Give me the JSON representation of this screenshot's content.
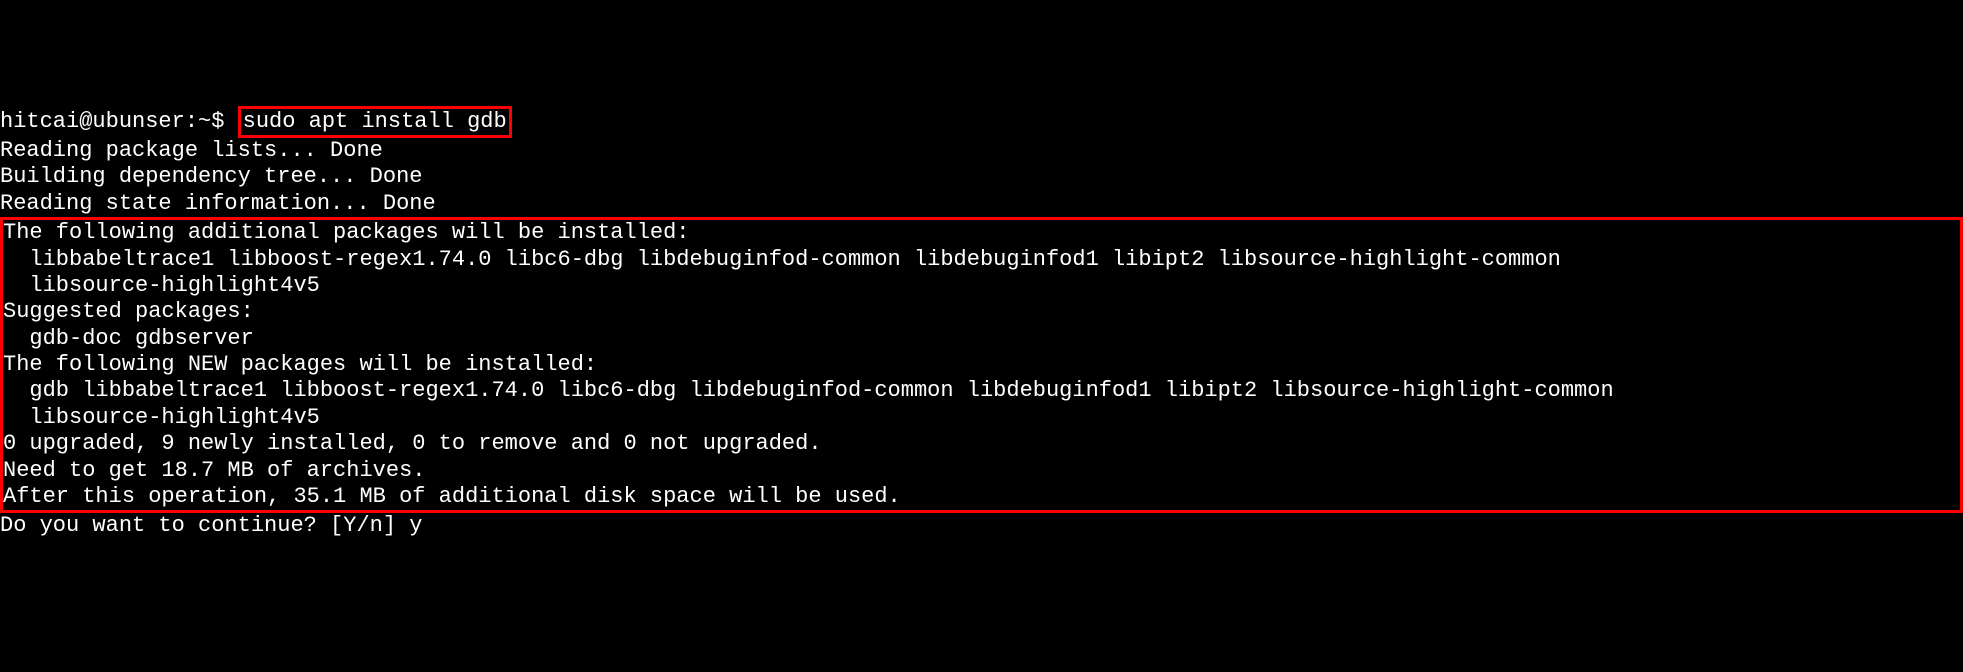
{
  "terminal": {
    "truncated_line": "hitcai@ubunser:~$",
    "prompt": "hitcai@ubunser:~$ ",
    "command": "sudo apt install gdb",
    "progress": {
      "line1": "Reading package lists... Done",
      "line2": "Building dependency tree... Done",
      "line3": "Reading state information... Done"
    },
    "box": {
      "line1": "The following additional packages will be installed:",
      "line2": "  libbabeltrace1 libboost-regex1.74.0 libc6-dbg libdebuginfod-common libdebuginfod1 libipt2 libsource-highlight-common",
      "line3": "  libsource-highlight4v5",
      "line4": "Suggested packages:",
      "line5": "  gdb-doc gdbserver",
      "line6": "The following NEW packages will be installed:",
      "line7": "  gdb libbabeltrace1 libboost-regex1.74.0 libc6-dbg libdebuginfod-common libdebuginfod1 libipt2 libsource-highlight-common",
      "line8": "  libsource-highlight4v5",
      "line9": "0 upgraded, 9 newly installed, 0 to remove and 0 not upgraded.",
      "line10": "Need to get 18.7 MB of archives.",
      "line11": "After this operation, 35.1 MB of additional disk space will be used."
    },
    "prompt_continue": "Do you want to continue? [Y/n] ",
    "response": "y"
  }
}
